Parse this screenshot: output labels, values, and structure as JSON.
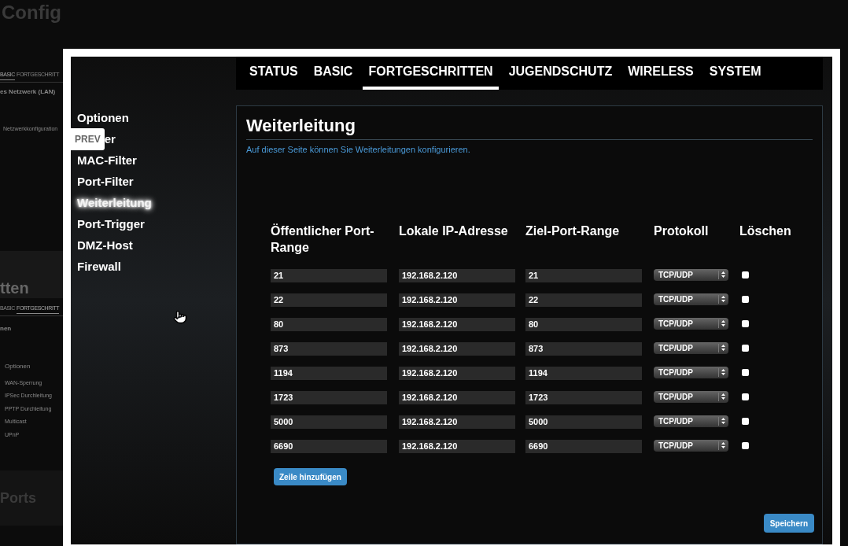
{
  "background_page": {
    "title": "Config",
    "tabs_1": [
      {
        "label": "BASIC",
        "selected": true
      },
      {
        "label": "FORTGESCHRITT",
        "selected": false
      }
    ],
    "heading_1": "es Netzwerk (LAN)",
    "section_1": "Netzwerkkonfiguration",
    "title_2": "tten",
    "tabs_2": [
      {
        "label": "BASIC",
        "selected": false
      },
      {
        "label": "FORTGESCHRITT",
        "selected": true
      }
    ],
    "heading_2": "nen",
    "section_2": "Optionen",
    "labels_2": [
      "WAN-Sperrung",
      "IPSec Durchleitung",
      "PPTP Durchleitung",
      "Multicast",
      "UPnP"
    ],
    "title_3": "Ports"
  },
  "lightbox": {
    "prev_button": "PREV",
    "nav": [
      {
        "label": "STATUS",
        "selected": false
      },
      {
        "label": "BASIC",
        "selected": false
      },
      {
        "label": "FORTGESCHRITTEN",
        "selected": true
      },
      {
        "label": "JUGENDSCHUTZ",
        "selected": false
      },
      {
        "label": "WIRELESS",
        "selected": false
      },
      {
        "label": "SYSTEM",
        "selected": false
      }
    ],
    "sidebar": [
      {
        "label": "Optionen",
        "selected": false
      },
      {
        "label": "er",
        "selected": false
      },
      {
        "label": "MAC-Filter",
        "selected": false
      },
      {
        "label": "Port-Filter",
        "selected": false
      },
      {
        "label": "Weiterleitung",
        "selected": true
      },
      {
        "label": "Port-Trigger",
        "selected": false
      },
      {
        "label": "DMZ-Host",
        "selected": false
      },
      {
        "label": "Firewall",
        "selected": false
      }
    ],
    "panel": {
      "title": "Weiterleitung",
      "description": "Auf dieser Seite können Sie Weiterleitungen konfigurieren.",
      "columns": [
        "Öffentlicher Port-Range",
        "Lokale IP-Adresse",
        "Ziel-Port-Range",
        "Protokoll",
        "Löschen"
      ],
      "rows": [
        {
          "public": "21",
          "ip": "192.168.2.120",
          "target": "21",
          "protocol": "TCP/UDP",
          "checked": false
        },
        {
          "public": "22",
          "ip": "192.168.2.120",
          "target": "22",
          "protocol": "TCP/UDP",
          "checked": false
        },
        {
          "public": "80",
          "ip": "192.168.2.120",
          "target": "80",
          "protocol": "TCP/UDP",
          "checked": false
        },
        {
          "public": "873",
          "ip": "192.168.2.120",
          "target": "873",
          "protocol": "TCP/UDP",
          "checked": false
        },
        {
          "public": "1194",
          "ip": "192.168.2.120",
          "target": "1194",
          "protocol": "TCP/UDP",
          "checked": false
        },
        {
          "public": "1723",
          "ip": "192.168.2.120",
          "target": "1723",
          "protocol": "TCP/UDP",
          "checked": false
        },
        {
          "public": "5000",
          "ip": "192.168.2.120",
          "target": "5000",
          "protocol": "TCP/UDP",
          "checked": false
        },
        {
          "public": "6690",
          "ip": "192.168.2.120",
          "target": "6690",
          "protocol": "TCP/UDP",
          "checked": false
        }
      ],
      "add_button": "Zeile hinzufügen",
      "save_button": "Speichern"
    }
  }
}
